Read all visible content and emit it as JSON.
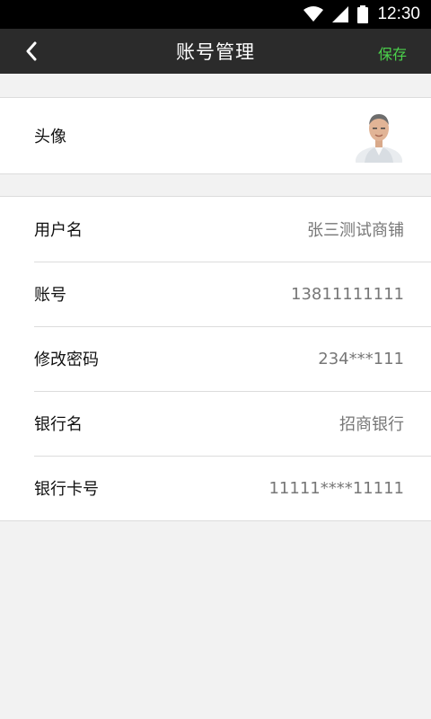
{
  "status_bar": {
    "time": "12:30",
    "icons": [
      "wifi-icon",
      "signal-icon",
      "battery-icon"
    ]
  },
  "toolbar": {
    "back_icon": "chevron-left-icon",
    "title": "账号管理",
    "save_label": "保存"
  },
  "avatar_section": {
    "label": "头像",
    "avatar_icon": "avatar-photo"
  },
  "info_rows": [
    {
      "label": "用户名",
      "value": "张三测试商铺"
    },
    {
      "label": "账号",
      "value": "13811111111"
    },
    {
      "label": "修改密码",
      "value": "234***111"
    },
    {
      "label": "银行名",
      "value": "招商银行"
    },
    {
      "label": "银行卡号",
      "value": "11111****11111"
    }
  ],
  "colors": {
    "status_bar_bg": "#000000",
    "toolbar_bg": "#2b2b2b",
    "accent_green": "#4bd24b",
    "page_bg": "#f2f2f2",
    "value_text": "#777777"
  }
}
